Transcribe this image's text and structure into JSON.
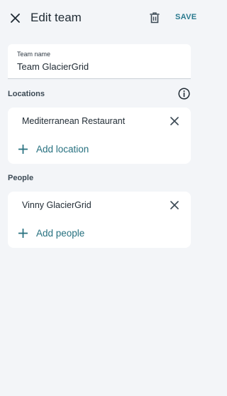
{
  "header": {
    "title": "Edit team",
    "save_label": "SAVE"
  },
  "team_name": {
    "label": "Team name",
    "value": "Team GlacierGrid"
  },
  "locations": {
    "heading": "Locations",
    "items": [
      {
        "label": "Mediterranean Restaurant"
      }
    ],
    "add_label": "Add location"
  },
  "people": {
    "heading": "People",
    "items": [
      {
        "label": "Vinny GlacierGrid"
      }
    ],
    "add_label": "Add people"
  },
  "colors": {
    "background": "#f3f5f8",
    "accent": "#2a7a8f",
    "text": "#1f2a33"
  }
}
